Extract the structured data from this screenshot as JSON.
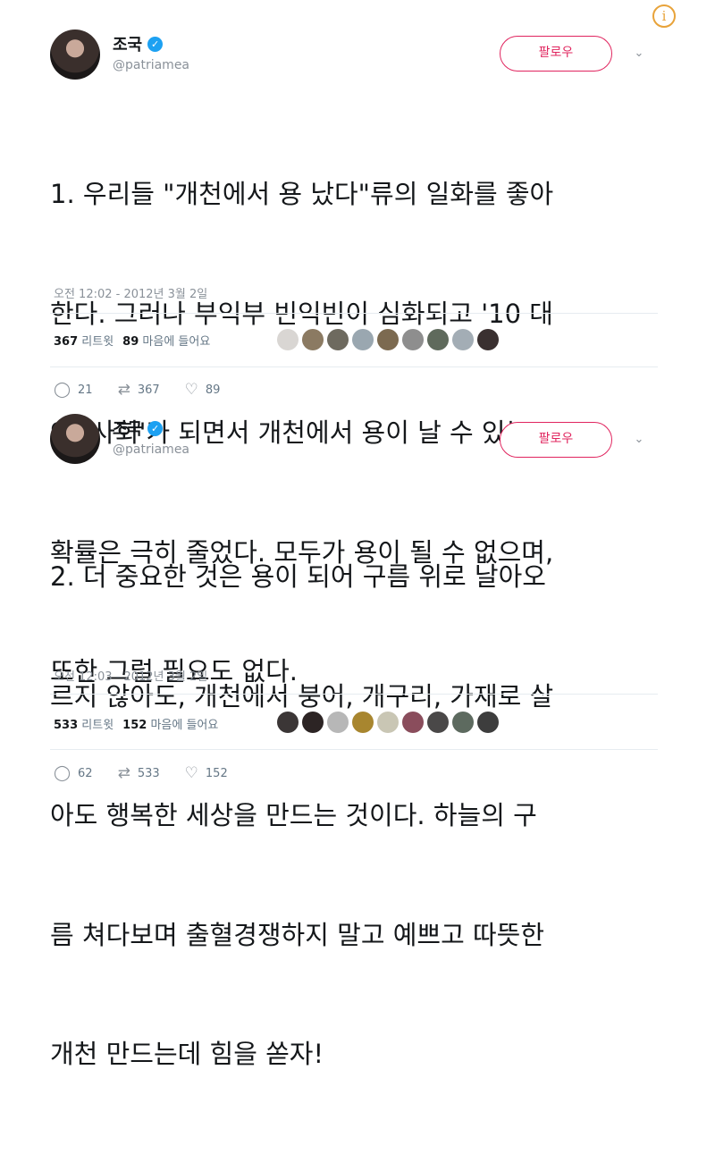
{
  "tweets": [
    {
      "author": {
        "name": "조국",
        "handle": "@patriamea"
      },
      "follow_label": "팔로우",
      "text_lines": [
        "1. 우리들 \"개천에서 용 났다\"류의 일화를 좋아",
        "한다. 그러나 부익부 빈익빈이 심화되고 '10 대",
        "90 사회'가 되면서 개천에서 용이 날 수 있는",
        "확률은 극히 줄었다. 모두가 용이 될 수 없으며,",
        "또한 그럴 필요도 없다."
      ],
      "timestamp": "오전 12:02 - 2012년 3월 2일",
      "retweets": {
        "count": "367",
        "label": "리트윗"
      },
      "likes": {
        "count": "89",
        "label": "마음에 들어요"
      },
      "liker_colors": [
        "#d9d6d3",
        "#8b7a62",
        "#6e6a5f",
        "#9aa7b0",
        "#7c6a50",
        "#8e8e8e",
        "#5f6a5c",
        "#a3adb5",
        "#3a3030"
      ],
      "actions": {
        "reply": "21",
        "retweet": "367",
        "like": "89"
      }
    },
    {
      "author": {
        "name": "조국",
        "handle": "@patriamea"
      },
      "follow_label": "팔로우",
      "text_lines": [
        "2. 더 중요한 것은 용이 되어 구름 위로 날아오",
        "르지 않아도, 개천에서 붕어, 개구리, 가재로 살",
        "아도 행복한 세상을 만드는 것이다. 하늘의 구",
        "름 쳐다보며 출혈경쟁하지 말고 예쁘고 따뜻한",
        "개천 만드는데 힘을 쏟자!"
      ],
      "timestamp": "오전 12:03 - 2012년 3월 2일",
      "retweets": {
        "count": "533",
        "label": "리트윗"
      },
      "likes": {
        "count": "152",
        "label": "마음에 들어요"
      },
      "liker_colors": [
        "#3b3636",
        "#2c2424",
        "#b7b7b7",
        "#a8862f",
        "#c9c6b4",
        "#8a4d5c",
        "#4a4848",
        "#5d6a5f",
        "#3d3d3d"
      ],
      "actions": {
        "reply": "62",
        "retweet": "533",
        "like": "152"
      }
    }
  ],
  "icons": {
    "info": "i",
    "verified": "✓",
    "chevron": "⌄",
    "reply": "◯",
    "retweet": "⇄",
    "like": "♡"
  }
}
